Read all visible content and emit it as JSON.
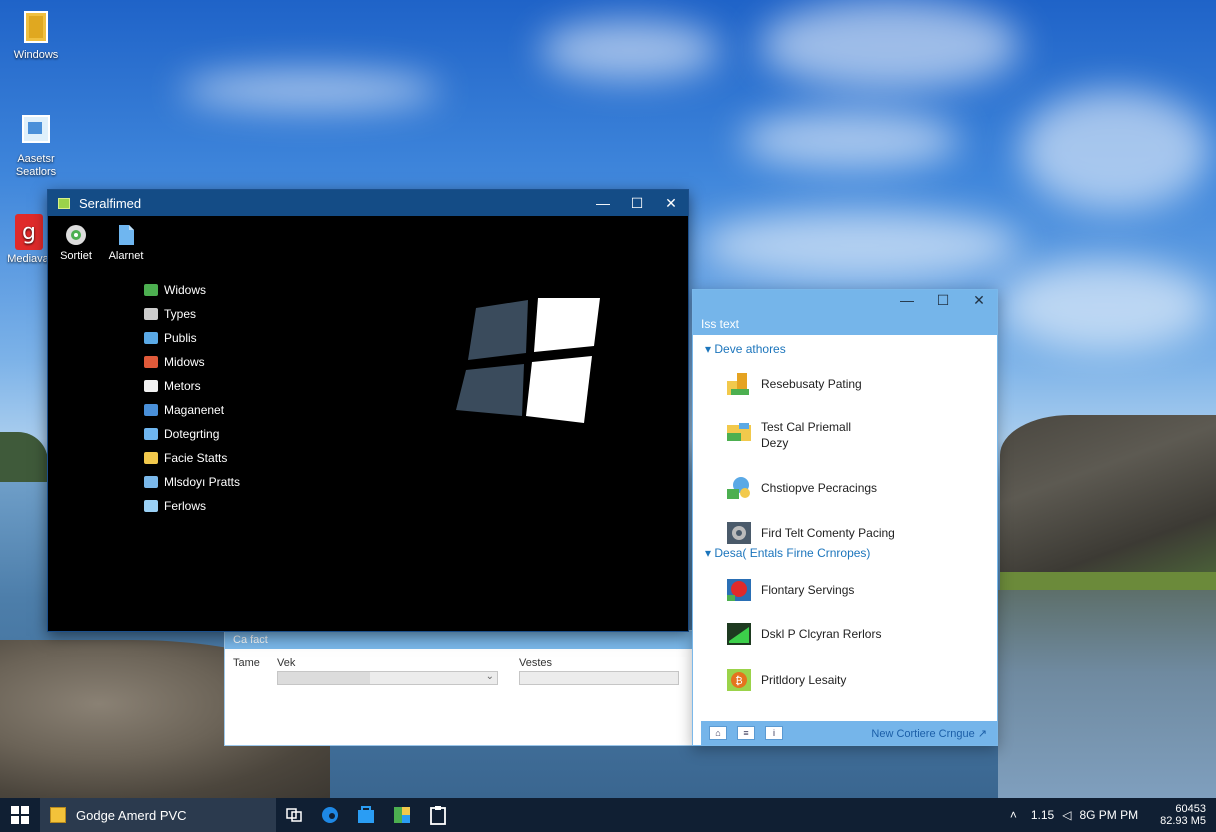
{
  "desktop": {
    "icons": [
      {
        "label": "Windows",
        "icon": "folder-icon"
      },
      {
        "label": "Aasetsr Seatlors",
        "icon": "computer-icon"
      },
      {
        "label": "Mediava",
        "icon": "media-app-icon"
      }
    ]
  },
  "window1": {
    "title": "Seralfimed",
    "top_icons": [
      {
        "label": "Sortiet",
        "icon": "disc-icon"
      },
      {
        "label": "Alarnet",
        "icon": "document-icon"
      }
    ],
    "menu": [
      {
        "label": "Widows",
        "color": "#4caf50"
      },
      {
        "label": "Types",
        "color": "#cccccc"
      },
      {
        "label": "Publis",
        "color": "#5aa9e6"
      },
      {
        "label": "Midows",
        "color": "#e05a3a"
      },
      {
        "label": "Metors",
        "color": "#f2f2f2"
      },
      {
        "label": "Maganenet",
        "color": "#4a90d9"
      },
      {
        "label": "Dotegrting",
        "color": "#6fb6f0"
      },
      {
        "label": "Facie Statts",
        "color": "#f2c94c"
      },
      {
        "label": "Mlsdoyı Pratts",
        "color": "#7ab8ea"
      },
      {
        "label": "Ferlows",
        "color": "#9ad0f5"
      }
    ]
  },
  "window2": {
    "title": "Ca fact",
    "label_time": "Tame",
    "label_veh": "Vek",
    "label_ventes": "Vestes"
  },
  "window3": {
    "title": "Iss text",
    "section1": "Deve athores",
    "section2": "Desa( Entals Firne Crnropes)",
    "items1": [
      {
        "label": "Resebusaty Pating",
        "icon": "yellow-blocks-icon"
      },
      {
        "label": "Test Cal Priemall",
        "label2": "Dezy",
        "icon": "folder-tools-icon"
      },
      {
        "label": "Chstiopve Pecracings",
        "icon": "network-globe-icon"
      },
      {
        "label": "Fird Telt Comenty Pacing",
        "icon": "disk-tool-icon"
      }
    ],
    "items2": [
      {
        "label": "Flontary Servings",
        "icon": "red-app-icon"
      },
      {
        "label": "Dskl P Clcyran Rerlors",
        "icon": "green-monitor-icon"
      },
      {
        "label": "Pritldory Lesaity",
        "icon": "orange-bitcoin-icon"
      }
    ],
    "footer_link": "New Cortiere Crngue"
  },
  "taskbar": {
    "app_label": "Godge Amerd PVC",
    "tray_text": "1.15",
    "tray_time_text": "8G PM PM",
    "clock_line1": "60453",
    "clock_line2": "82.93 M5"
  },
  "colors": {
    "accent": "#75b5ea",
    "titlebar_dark": "#144c86",
    "taskbar": "#101f33"
  }
}
